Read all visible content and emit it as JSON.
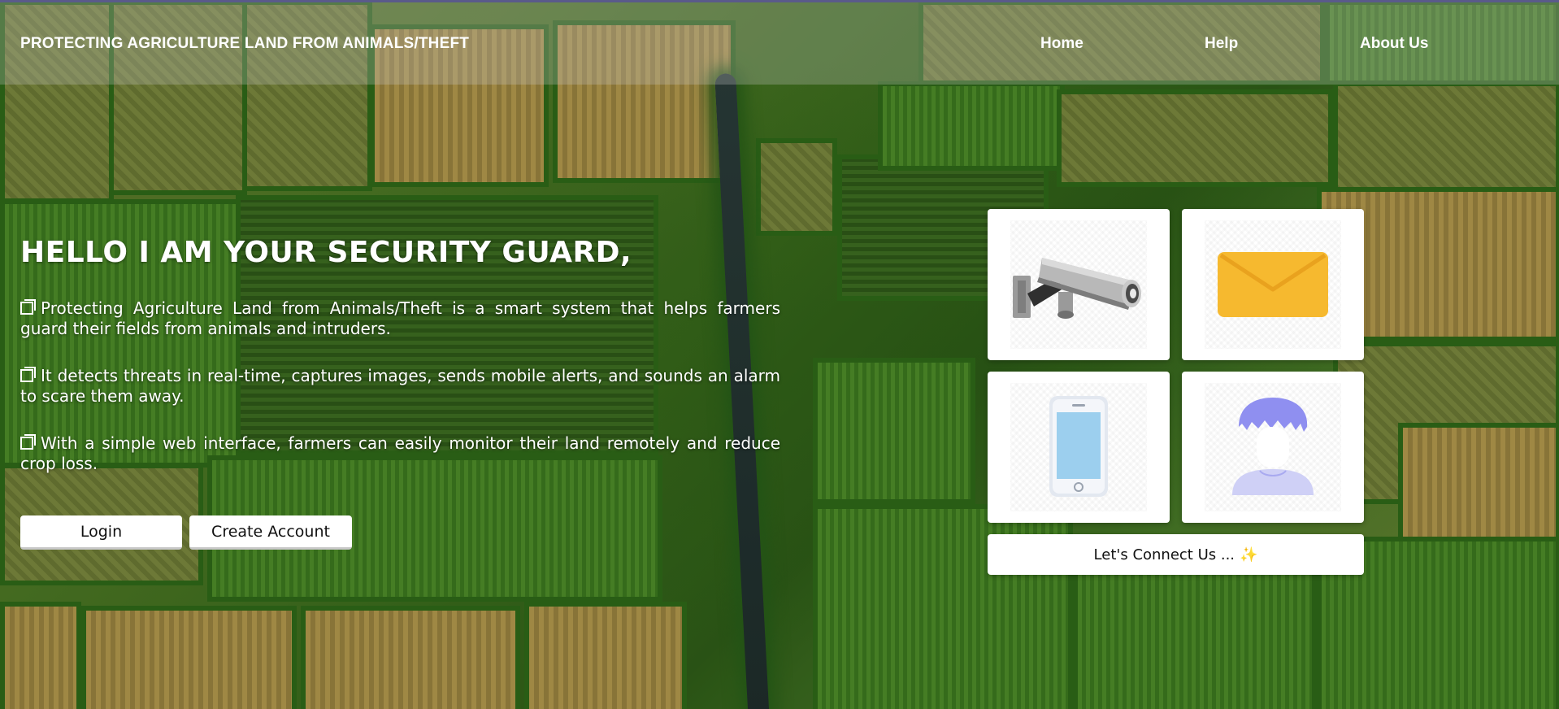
{
  "header": {
    "title": "PROTECTING AGRICULTURE LAND FROM ANIMALS/THEFT",
    "nav": [
      {
        "label": "Home"
      },
      {
        "label": "Help"
      },
      {
        "label": "About Us"
      }
    ]
  },
  "hero": {
    "heading": "HELLO I AM YOUR SECURITY GUARD,",
    "paragraphs": [
      "Protecting Agriculture Land from Animals/Theft is a smart system that helps farmers guard their fields from animals and intruders.",
      "It detects threats in real-time, captures images, sends mobile alerts, and sounds an alarm to scare them away.",
      "With a simple web interface, farmers can easily monitor their land remotely and reduce crop loss."
    ],
    "buttons": {
      "login": "Login",
      "create_account": "Create Account"
    }
  },
  "cards": [
    {
      "icon": "security-camera-icon"
    },
    {
      "icon": "envelope-icon"
    },
    {
      "icon": "smartphone-icon"
    },
    {
      "icon": "user-avatar-icon"
    }
  ],
  "connect": {
    "label": "Let's Connect Us ...",
    "emoji": "✨"
  },
  "colors": {
    "header_overlay": "rgba(200,200,200,0.28)",
    "text_light": "#ffffff",
    "card_bg": "#ffffff",
    "envelope": "#f6b92f",
    "phone_screen": "#9ccfee",
    "avatar_hair": "#8f8ff0"
  }
}
